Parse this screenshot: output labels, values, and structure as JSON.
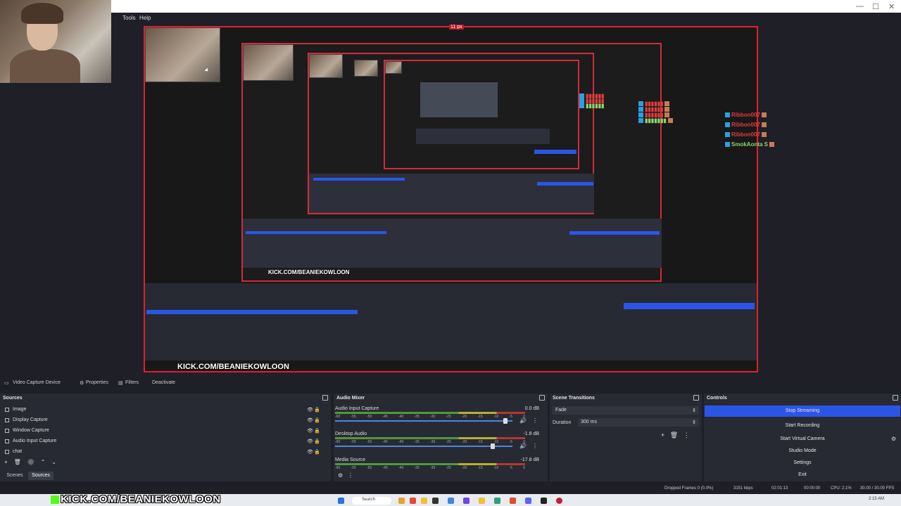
{
  "menu": {
    "tools": "Tools",
    "help": "Help"
  },
  "preview": {
    "size_label": "11 px",
    "chat": [
      {
        "user": "Ribbon007",
        "style": "red"
      },
      {
        "user": "Ribbon007",
        "style": "red"
      },
      {
        "user": "Ribbon007",
        "style": "red"
      },
      {
        "user": "SmokAonta S",
        "style": "green"
      }
    ],
    "overlay_text": "KICK.COM/BEANIEKOWLOON"
  },
  "source_toolbar": {
    "device": "Video Capture Device",
    "properties": "Properties",
    "filters": "Filters",
    "deactivate": "Deactivate"
  },
  "sources": {
    "title": "Sources",
    "items": [
      {
        "label": "Image",
        "icon": "image-icon"
      },
      {
        "label": "Display Capture",
        "icon": "display-icon"
      },
      {
        "label": "Window Capture",
        "icon": "window-icon"
      },
      {
        "label": "Audio Input Capture",
        "icon": "mic-icon"
      },
      {
        "label": "chat",
        "icon": "browser-icon"
      }
    ],
    "tabs": {
      "scenes": "Scenes",
      "sources": "Sources"
    }
  },
  "mixer": {
    "title": "Audio Mixer",
    "channels": [
      {
        "name": "Audio Input Capture",
        "db": "0.0 dB",
        "level": 0.97
      },
      {
        "name": "Desktop Audio",
        "db": "-1.8 dB",
        "level": 0.9
      },
      {
        "name": "Media Source",
        "db": "-17.8 dB",
        "level": 0.3
      }
    ],
    "ticks": [
      "-60",
      "-55",
      "-50",
      "-45",
      "-40",
      "-35",
      "-30",
      "-25",
      "-20",
      "-15",
      "-10",
      "-5",
      "0"
    ]
  },
  "transitions": {
    "title": "Scene Transitions",
    "type": "Fade",
    "duration_label": "Duration",
    "duration": "300 ms"
  },
  "controls": {
    "title": "Controls",
    "buttons": [
      "Stop Streaming",
      "Start Recording",
      "Start Virtual Camera",
      "Studio Mode",
      "Settings",
      "Exit"
    ]
  },
  "status": {
    "dropped": "Dropped Frames 0 (0.0%)",
    "kbps": "3151 kbps",
    "stream_time": "02:01:13",
    "rec_time": "00:00:00",
    "cpu": "CPU: 2.1%",
    "fps": "30.00 / 30.00 FPS"
  },
  "taskbar": {
    "search": "Search",
    "clock": "2:15 AM"
  },
  "overlay_text": "KICK.COM/BEANIEKOWLOON",
  "colors": {
    "accent": "#2a56e8",
    "recording_border": "#e0202e",
    "kick_green": "#53fc18"
  }
}
